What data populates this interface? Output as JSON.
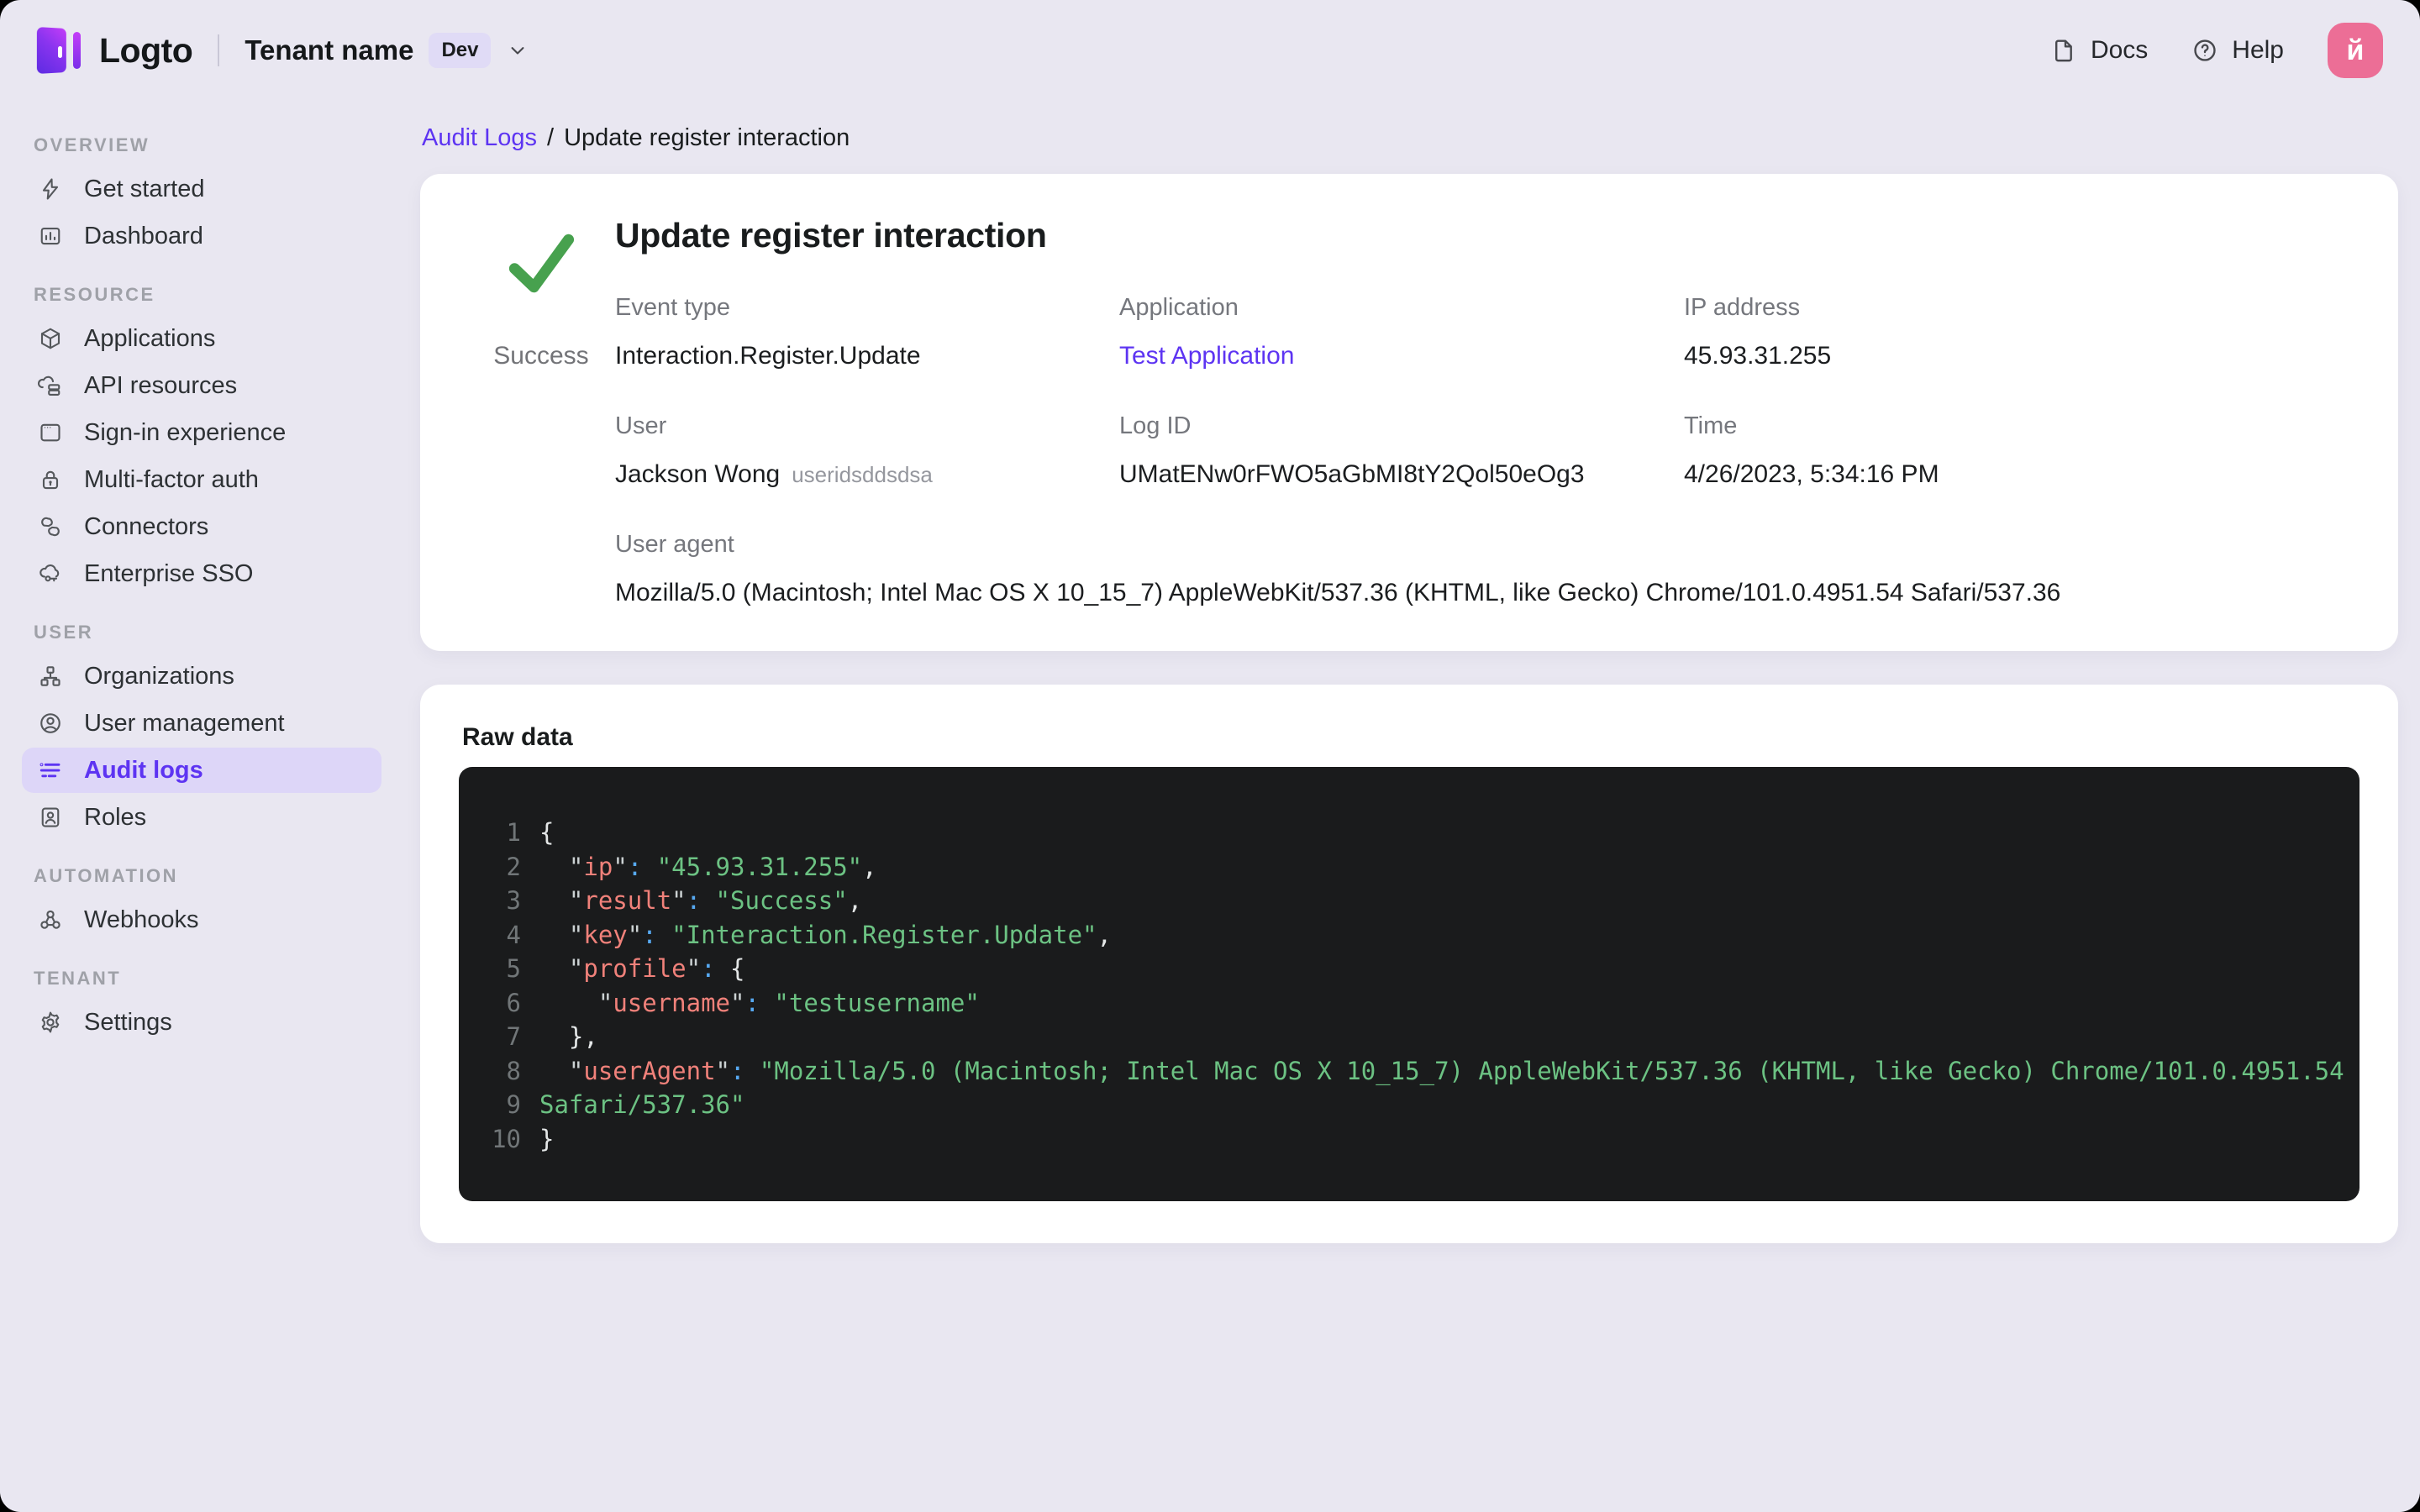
{
  "topbar": {
    "brand": "Logto",
    "tenant_name": "Tenant name",
    "tenant_badge": "Dev",
    "docs_label": "Docs",
    "help_label": "Help",
    "avatar_letter": "й"
  },
  "sidebar": {
    "sections": [
      {
        "title": "OVERVIEW",
        "items": [
          {
            "label": "Get started"
          },
          {
            "label": "Dashboard"
          }
        ]
      },
      {
        "title": "RESOURCE",
        "items": [
          {
            "label": "Applications"
          },
          {
            "label": "API resources"
          },
          {
            "label": "Sign-in experience"
          },
          {
            "label": "Multi-factor auth"
          },
          {
            "label": "Connectors"
          },
          {
            "label": "Enterprise SSO"
          }
        ]
      },
      {
        "title": "USER",
        "items": [
          {
            "label": "Organizations"
          },
          {
            "label": "User management"
          },
          {
            "label": "Audit logs"
          },
          {
            "label": "Roles"
          }
        ]
      },
      {
        "title": "AUTOMATION",
        "items": [
          {
            "label": "Webhooks"
          }
        ]
      },
      {
        "title": "TENANT",
        "items": [
          {
            "label": "Settings"
          }
        ]
      }
    ]
  },
  "breadcrumb": {
    "parent": "Audit Logs",
    "separator": "/",
    "current": "Update register interaction"
  },
  "detail": {
    "title": "Update register interaction",
    "status": "Success",
    "fields": [
      {
        "label": "Event type",
        "value": "Interaction.Register.Update"
      },
      {
        "label": "Application",
        "value": "Test Application"
      },
      {
        "label": "IP address",
        "value": "45.93.31.255"
      },
      {
        "label": "User",
        "value": "Jackson Wong",
        "suffix": "useridsddsdsa"
      },
      {
        "label": "Log ID",
        "value": "UMatENw0rFWO5aGbMI8tY2Qol50eOg3"
      },
      {
        "label": "Time",
        "value": "4/26/2023, 5:34:16 PM"
      },
      {
        "label": "User agent",
        "value": "Mozilla/5.0 (Macintosh; Intel Mac OS X 10_15_7) AppleWebKit/537.36 (KHTML, like Gecko) Chrome/101.0.4951.54 Safari/537.36"
      }
    ]
  },
  "raw_data": {
    "title": "Raw data",
    "lines": [
      {
        "num": "1",
        "tokens": [
          [
            "p",
            "{"
          ]
        ]
      },
      {
        "num": "2",
        "tokens": [
          [
            "q",
            "  \""
          ],
          [
            "k",
            "ip"
          ],
          [
            "q",
            "\""
          ],
          [
            "c",
            ":"
          ],
          [
            "s",
            " \"45.93.31.255\""
          ],
          [
            "p",
            ","
          ]
        ]
      },
      {
        "num": "3",
        "tokens": [
          [
            "q",
            "  \""
          ],
          [
            "k",
            "result"
          ],
          [
            "q",
            "\""
          ],
          [
            "c",
            ":"
          ],
          [
            "s",
            " \"Success\""
          ],
          [
            "p",
            ","
          ]
        ]
      },
      {
        "num": "4",
        "tokens": [
          [
            "q",
            "  \""
          ],
          [
            "k",
            "key"
          ],
          [
            "q",
            "\""
          ],
          [
            "c",
            ":"
          ],
          [
            "s",
            " \"Interaction.Register.Update\""
          ],
          [
            "p",
            ","
          ]
        ]
      },
      {
        "num": "5",
        "tokens": [
          [
            "q",
            "  \""
          ],
          [
            "k",
            "profile"
          ],
          [
            "q",
            "\""
          ],
          [
            "c",
            ":"
          ],
          [
            "p",
            " {"
          ]
        ]
      },
      {
        "num": "6",
        "tokens": [
          [
            "q",
            "    \""
          ],
          [
            "k",
            "username"
          ],
          [
            "q",
            "\""
          ],
          [
            "c",
            ":"
          ],
          [
            "s",
            " \"testusername\""
          ]
        ]
      },
      {
        "num": "7",
        "tokens": [
          [
            "p",
            "  },"
          ]
        ]
      },
      {
        "num": "8",
        "tokens": [
          [
            "q",
            "  \""
          ],
          [
            "k",
            "userAgent"
          ],
          [
            "q",
            "\""
          ],
          [
            "c",
            ":"
          ],
          [
            "s",
            " \"Mozilla/5.0 (Macintosh; Intel Mac OS X 10_15_7) AppleWebKit/537.36 (KHTML, like Gecko) Chrome/101.0.4951.54"
          ]
        ]
      },
      {
        "num": "9",
        "tokens": [
          [
            "s",
            "Safari/537.36\""
          ]
        ]
      },
      {
        "num": "10",
        "tokens": [
          [
            "p",
            "}"
          ]
        ]
      }
    ]
  },
  "colors": {
    "accent_purple": "#5d34f2",
    "active_pill": "#ddd6f8",
    "success_green": "#47a14e",
    "avatar_pink": "#ec6e96",
    "page_bg": "#e9e7f1",
    "code_bg": "#1a1b1c",
    "code_key": "#f0817a",
    "code_string": "#6cc283",
    "code_colon": "#57a9f1"
  }
}
